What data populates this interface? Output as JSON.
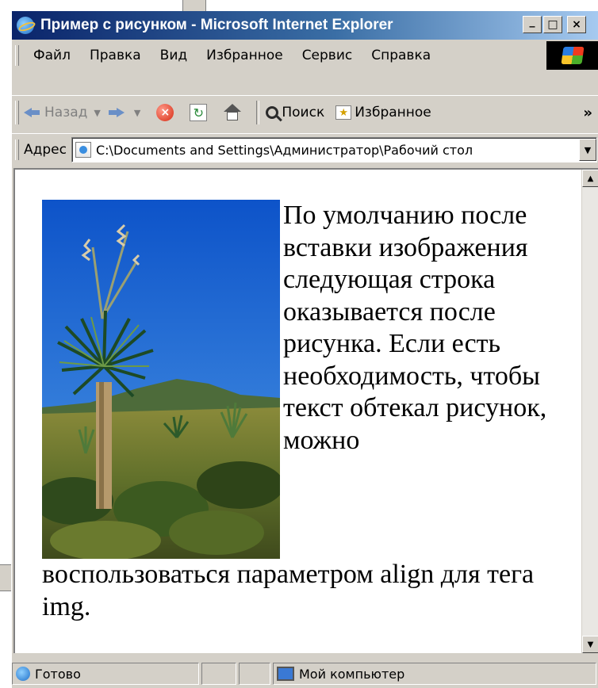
{
  "window": {
    "title": "Пример с рисунком - Microsoft Internet Explorer",
    "minimize_glyph": "_",
    "maximize_glyph": "□",
    "close_glyph": "×"
  },
  "menu": [
    "Файл",
    "Правка",
    "Вид",
    "Избранное",
    "Сервис",
    "Справка"
  ],
  "toolbar": {
    "back_label": "Назад",
    "search_label": "Поиск",
    "favorites_label": "Избранное",
    "more_glyph": "»"
  },
  "address": {
    "label": "Адрес",
    "value": "C:\\Documents and Settings\\Администратор\\Рабочий стол"
  },
  "article": {
    "text_wrapped": "По умолчанию после вставки изображения следующая строка оказывается после рисунка. Если есть необходимость, чтобы текст обтекал рисунок, можно",
    "text_after": "воспользоваться параметром align для тега img."
  },
  "status": {
    "text": "Готово",
    "zone": "Мой компьютер"
  },
  "icons": {
    "app": "ie-icon",
    "back": "back-arrow-icon",
    "forward": "forward-arrow-icon",
    "stop": "stop-icon",
    "refresh": "refresh-icon",
    "home": "home-icon",
    "search": "search-icon",
    "favorites": "favorites-icon",
    "page": "page-icon",
    "zone": "computer-icon"
  }
}
